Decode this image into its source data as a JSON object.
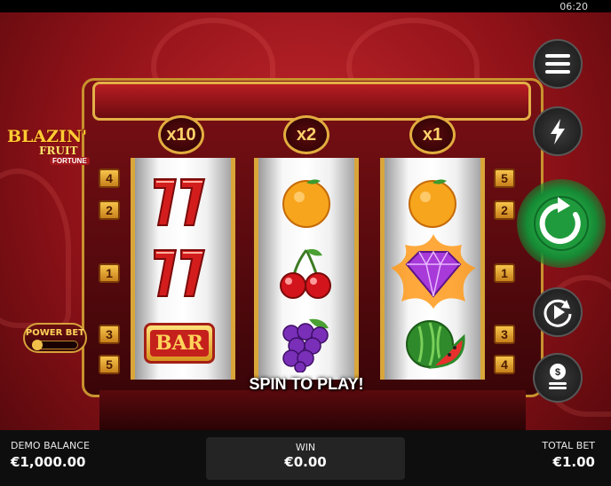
{
  "status_bar": {
    "time": "06:20"
  },
  "logo": {
    "line1": "BLAZIN'",
    "line2": "FRUIT",
    "line3": "FORTUNE"
  },
  "multipliers": [
    "x10",
    "x2",
    "x1"
  ],
  "paylines_left": [
    "4",
    "2",
    "1",
    "3",
    "5"
  ],
  "paylines_right": [
    "5",
    "2",
    "1",
    "3",
    "4"
  ],
  "reels": [
    [
      "seven-symbol",
      "seven-symbol",
      "bar-symbol"
    ],
    [
      "orange-symbol",
      "cherry-symbol",
      "grapes-symbol"
    ],
    [
      "orange-symbol",
      "diamond-symbol",
      "watermelon-symbol"
    ]
  ],
  "bar_symbol_text": "BAR",
  "power_bet": {
    "label": "POWER BET",
    "enabled": false
  },
  "side_buttons": [
    "menu-icon",
    "lightning-icon",
    "spin-icon",
    "autoplay-icon",
    "coins-icon"
  ],
  "message": "SPIN TO PLAY!",
  "footer": {
    "balance_label": "DEMO BALANCE",
    "balance_value": "€1,000.00",
    "win_label": "WIN",
    "win_value": "€0.00",
    "bet_label": "TOTAL BET",
    "bet_value": "€1.00"
  },
  "colors": {
    "background": "#a3181c",
    "gold": "#e2ad3e",
    "spin": "#2fc24f"
  }
}
